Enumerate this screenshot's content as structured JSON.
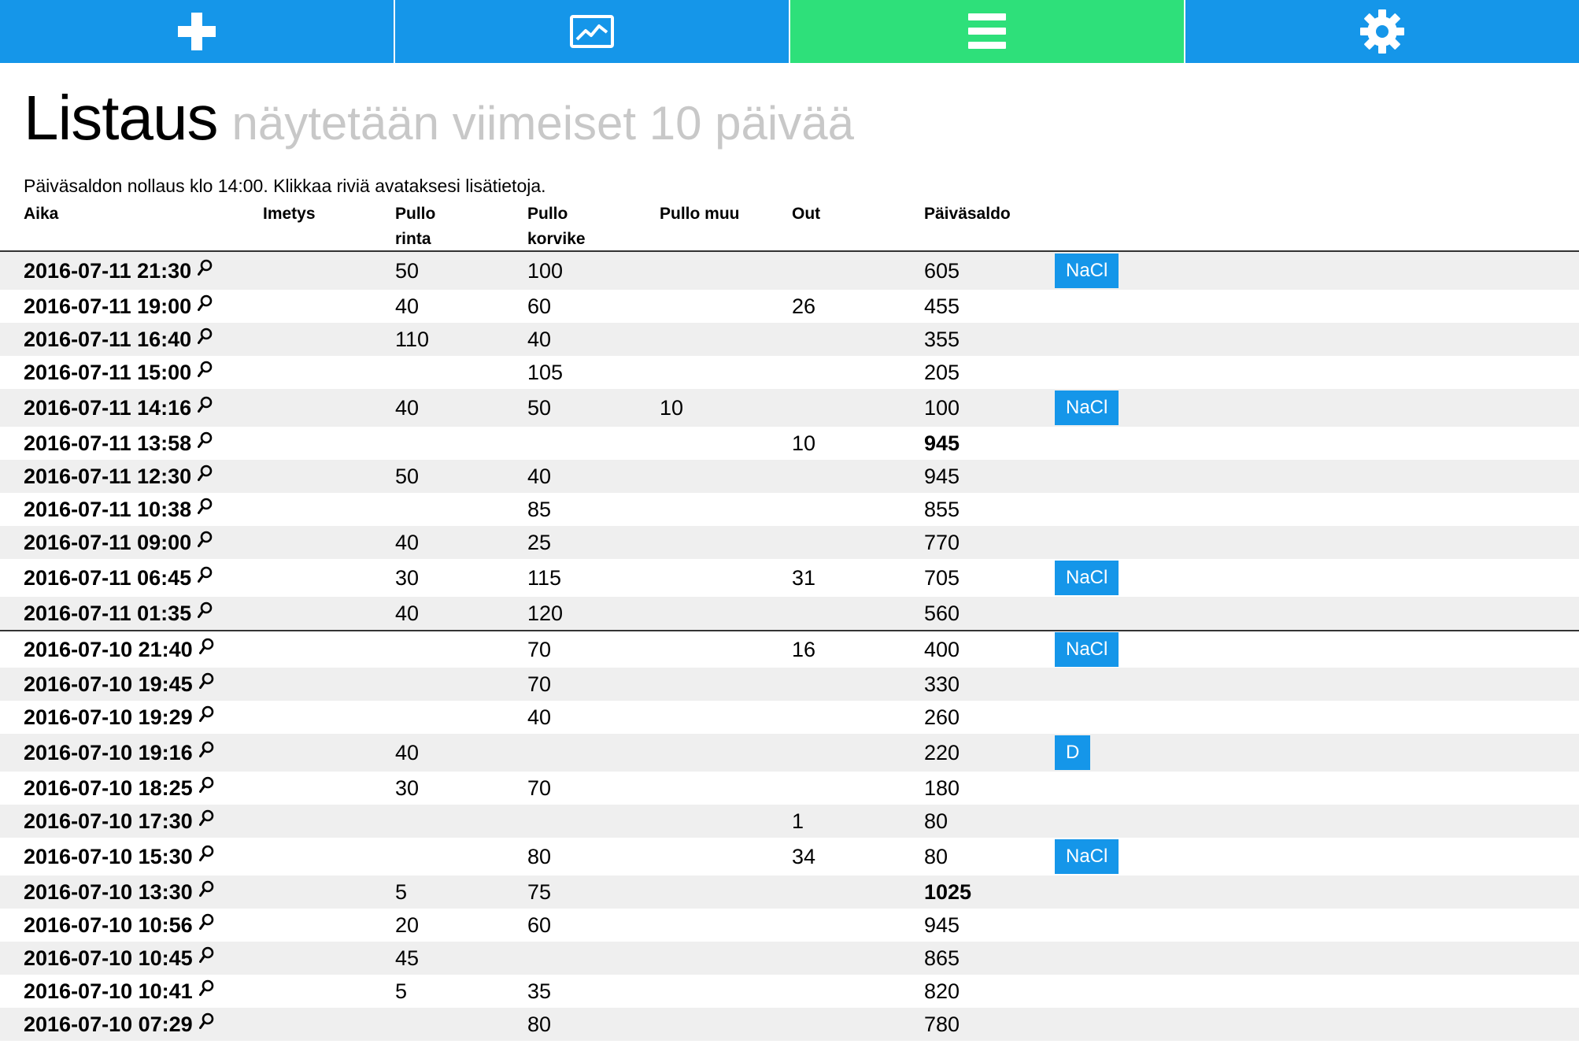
{
  "nav": {
    "items": [
      {
        "name": "add",
        "icon": "plus-icon",
        "color": "#1596e9"
      },
      {
        "name": "chart",
        "icon": "chart-icon",
        "color": "#1596e9"
      },
      {
        "name": "list",
        "icon": "list-icon",
        "color": "#2ee07a"
      },
      {
        "name": "settings",
        "icon": "gear-icon",
        "color": "#1596e9"
      }
    ],
    "active": "list"
  },
  "page": {
    "title": "Listaus",
    "subtitle": "näytetään viimeiset 10 päivää",
    "info": "Päiväsaldon nollaus klo 14:00. Klikkaa riviä avataksesi lisätietoja."
  },
  "table": {
    "headers": {
      "aika": "Aika",
      "imetys": "Imetys",
      "pullo_rinta_1": "Pullo",
      "pullo_rinta_2": "rinta",
      "pullo_korvike_1": "Pullo",
      "pullo_korvike_2": "korvike",
      "pullo_muu": "Pullo muu",
      "out": "Out",
      "paivasaldo": "Päiväsaldo"
    },
    "rows": [
      {
        "time": "2016-07-11 21:30",
        "imetys": "",
        "rinta": "50",
        "korvike": "100",
        "muu": "",
        "out": "",
        "saldo": "605",
        "bold": false,
        "tag": "NaCl"
      },
      {
        "time": "2016-07-11 19:00",
        "imetys": "",
        "rinta": "40",
        "korvike": "60",
        "muu": "",
        "out": "26",
        "saldo": "455",
        "bold": false,
        "tag": ""
      },
      {
        "time": "2016-07-11 16:40",
        "imetys": "",
        "rinta": "110",
        "korvike": "40",
        "muu": "",
        "out": "",
        "saldo": "355",
        "bold": false,
        "tag": ""
      },
      {
        "time": "2016-07-11 15:00",
        "imetys": "",
        "rinta": "",
        "korvike": "105",
        "muu": "",
        "out": "",
        "saldo": "205",
        "bold": false,
        "tag": ""
      },
      {
        "time": "2016-07-11 14:16",
        "imetys": "",
        "rinta": "40",
        "korvike": "50",
        "muu": "10",
        "out": "",
        "saldo": "100",
        "bold": false,
        "tag": "NaCl"
      },
      {
        "time": "2016-07-11 13:58",
        "imetys": "",
        "rinta": "",
        "korvike": "",
        "muu": "",
        "out": "10",
        "saldo": "945",
        "bold": true,
        "tag": ""
      },
      {
        "time": "2016-07-11 12:30",
        "imetys": "",
        "rinta": "50",
        "korvike": "40",
        "muu": "",
        "out": "",
        "saldo": "945",
        "bold": false,
        "tag": ""
      },
      {
        "time": "2016-07-11 10:38",
        "imetys": "",
        "rinta": "",
        "korvike": "85",
        "muu": "",
        "out": "",
        "saldo": "855",
        "bold": false,
        "tag": ""
      },
      {
        "time": "2016-07-11 09:00",
        "imetys": "",
        "rinta": "40",
        "korvike": "25",
        "muu": "",
        "out": "",
        "saldo": "770",
        "bold": false,
        "tag": ""
      },
      {
        "time": "2016-07-11 06:45",
        "imetys": "",
        "rinta": "30",
        "korvike": "115",
        "muu": "",
        "out": "31",
        "saldo": "705",
        "bold": false,
        "tag": "NaCl"
      },
      {
        "time": "2016-07-11 01:35",
        "imetys": "",
        "rinta": "40",
        "korvike": "120",
        "muu": "",
        "out": "",
        "saldo": "560",
        "bold": false,
        "tag": ""
      },
      {
        "time": "2016-07-10 21:40",
        "imetys": "",
        "rinta": "",
        "korvike": "70",
        "muu": "",
        "out": "16",
        "saldo": "400",
        "bold": false,
        "tag": "NaCl",
        "daybreak": true
      },
      {
        "time": "2016-07-10 19:45",
        "imetys": "",
        "rinta": "",
        "korvike": "70",
        "muu": "",
        "out": "",
        "saldo": "330",
        "bold": false,
        "tag": ""
      },
      {
        "time": "2016-07-10 19:29",
        "imetys": "",
        "rinta": "",
        "korvike": "40",
        "muu": "",
        "out": "",
        "saldo": "260",
        "bold": false,
        "tag": ""
      },
      {
        "time": "2016-07-10 19:16",
        "imetys": "",
        "rinta": "40",
        "korvike": "",
        "muu": "",
        "out": "",
        "saldo": "220",
        "bold": false,
        "tag": "D"
      },
      {
        "time": "2016-07-10 18:25",
        "imetys": "",
        "rinta": "30",
        "korvike": "70",
        "muu": "",
        "out": "",
        "saldo": "180",
        "bold": false,
        "tag": ""
      },
      {
        "time": "2016-07-10 17:30",
        "imetys": "",
        "rinta": "",
        "korvike": "",
        "muu": "",
        "out": "1",
        "saldo": "80",
        "bold": false,
        "tag": ""
      },
      {
        "time": "2016-07-10 15:30",
        "imetys": "",
        "rinta": "",
        "korvike": "80",
        "muu": "",
        "out": "34",
        "saldo": "80",
        "bold": false,
        "tag": "NaCl"
      },
      {
        "time": "2016-07-10 13:30",
        "imetys": "",
        "rinta": "5",
        "korvike": "75",
        "muu": "",
        "out": "",
        "saldo": "1025",
        "bold": true,
        "tag": ""
      },
      {
        "time": "2016-07-10 10:56",
        "imetys": "",
        "rinta": "20",
        "korvike": "60",
        "muu": "",
        "out": "",
        "saldo": "945",
        "bold": false,
        "tag": ""
      },
      {
        "time": "2016-07-10 10:45",
        "imetys": "",
        "rinta": "45",
        "korvike": "",
        "muu": "",
        "out": "",
        "saldo": "865",
        "bold": false,
        "tag": ""
      },
      {
        "time": "2016-07-10 10:41",
        "imetys": "",
        "rinta": "5",
        "korvike": "35",
        "muu": "",
        "out": "",
        "saldo": "820",
        "bold": false,
        "tag": ""
      },
      {
        "time": "2016-07-10 07:29",
        "imetys": "",
        "rinta": "",
        "korvike": "80",
        "muu": "",
        "out": "",
        "saldo": "780",
        "bold": false,
        "tag": ""
      }
    ]
  }
}
